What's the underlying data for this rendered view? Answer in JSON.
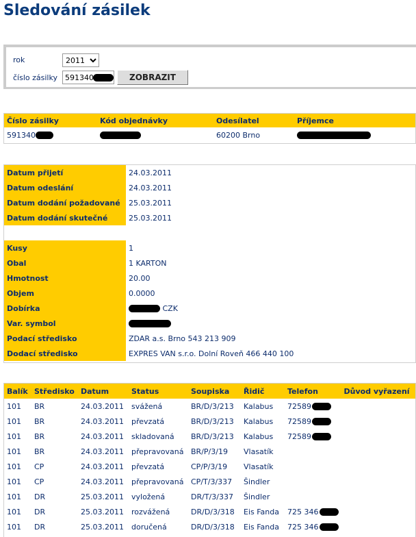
{
  "page": {
    "title": "Sledování zásilek"
  },
  "form": {
    "year_label": "rok",
    "year_value": "2011",
    "shipment_label": "číslo zásilky",
    "shipment_value": "591340",
    "submit_label": "ZOBRAZIT"
  },
  "summary": {
    "headers": [
      "Číslo zásilky",
      "Kód objednávky",
      "Odesílatel",
      "Příjemce"
    ],
    "shipment_no": "591340",
    "sender": "60200 Brno"
  },
  "details": {
    "dates": [
      {
        "label": "Datum přijetí",
        "value": "24.03.2011"
      },
      {
        "label": "Datum odeslání",
        "value": "24.03.2011"
      },
      {
        "label": "Datum dodání požadované",
        "value": "25.03.2011"
      },
      {
        "label": "Datum dodání skutečné",
        "value": "25.03.2011"
      }
    ],
    "pieces_label": "Kusy",
    "pieces_value": "1",
    "packaging_label": "Obal",
    "packaging_value": "1 KARTON",
    "weight_label": "Hmotnost",
    "weight_value": "20.00",
    "volume_label": "Objem",
    "volume_value": "0.0000",
    "cod_label": "Dobírka",
    "cod_currency": "CZK",
    "varsym_label": "Var. symbol",
    "origin_label": "Podací středisko",
    "origin_value": "ZDAR a.s. Brno 543 213 909",
    "dest_label": "Dodací středisko",
    "dest_value": "EXPRES VAN s.r.o. Dolní Roveň 466 440 100"
  },
  "history": {
    "headers": [
      "Balík",
      "Středisko",
      "Datum",
      "Status",
      "Soupiska",
      "Řidič",
      "Telefon",
      "Důvod vyřazení"
    ],
    "rows": [
      {
        "parcel": "101",
        "center": "BR",
        "date": "24.03.2011",
        "status": "svážená",
        "list": "BR/D/3/213",
        "driver": "Kalabus",
        "phone": "72589"
      },
      {
        "parcel": "101",
        "center": "BR",
        "date": "24.03.2011",
        "status": "převzatá",
        "list": "BR/D/3/213",
        "driver": "Kalabus",
        "phone": "72589"
      },
      {
        "parcel": "101",
        "center": "BR",
        "date": "24.03.2011",
        "status": "skladovaná",
        "list": "BR/D/3/213",
        "driver": "Kalabus",
        "phone": "72589"
      },
      {
        "parcel": "101",
        "center": "BR",
        "date": "24.03.2011",
        "status": "přepravovaná",
        "list": "BR/P/3/19",
        "driver": "Vlasatík",
        "phone": ""
      },
      {
        "parcel": "101",
        "center": "CP",
        "date": "24.03.2011",
        "status": "převzatá",
        "list": "CP/P/3/19",
        "driver": "Vlasatík",
        "phone": ""
      },
      {
        "parcel": "101",
        "center": "CP",
        "date": "24.03.2011",
        "status": "přepravovaná",
        "list": "CP/T/3/337",
        "driver": "Šindler",
        "phone": ""
      },
      {
        "parcel": "101",
        "center": "DR",
        "date": "25.03.2011",
        "status": "vyložená",
        "list": "DR/T/3/337",
        "driver": "Šindler",
        "phone": ""
      },
      {
        "parcel": "101",
        "center": "DR",
        "date": "25.03.2011",
        "status": "rozvážená",
        "list": "DR/D/3/318",
        "driver": "Eis Fanda",
        "phone": "725 346"
      },
      {
        "parcel": "101",
        "center": "DR",
        "date": "25.03.2011",
        "status": "doručená",
        "list": "DR/D/3/318",
        "driver": "Eis Fanda",
        "phone": "725 346"
      }
    ]
  }
}
